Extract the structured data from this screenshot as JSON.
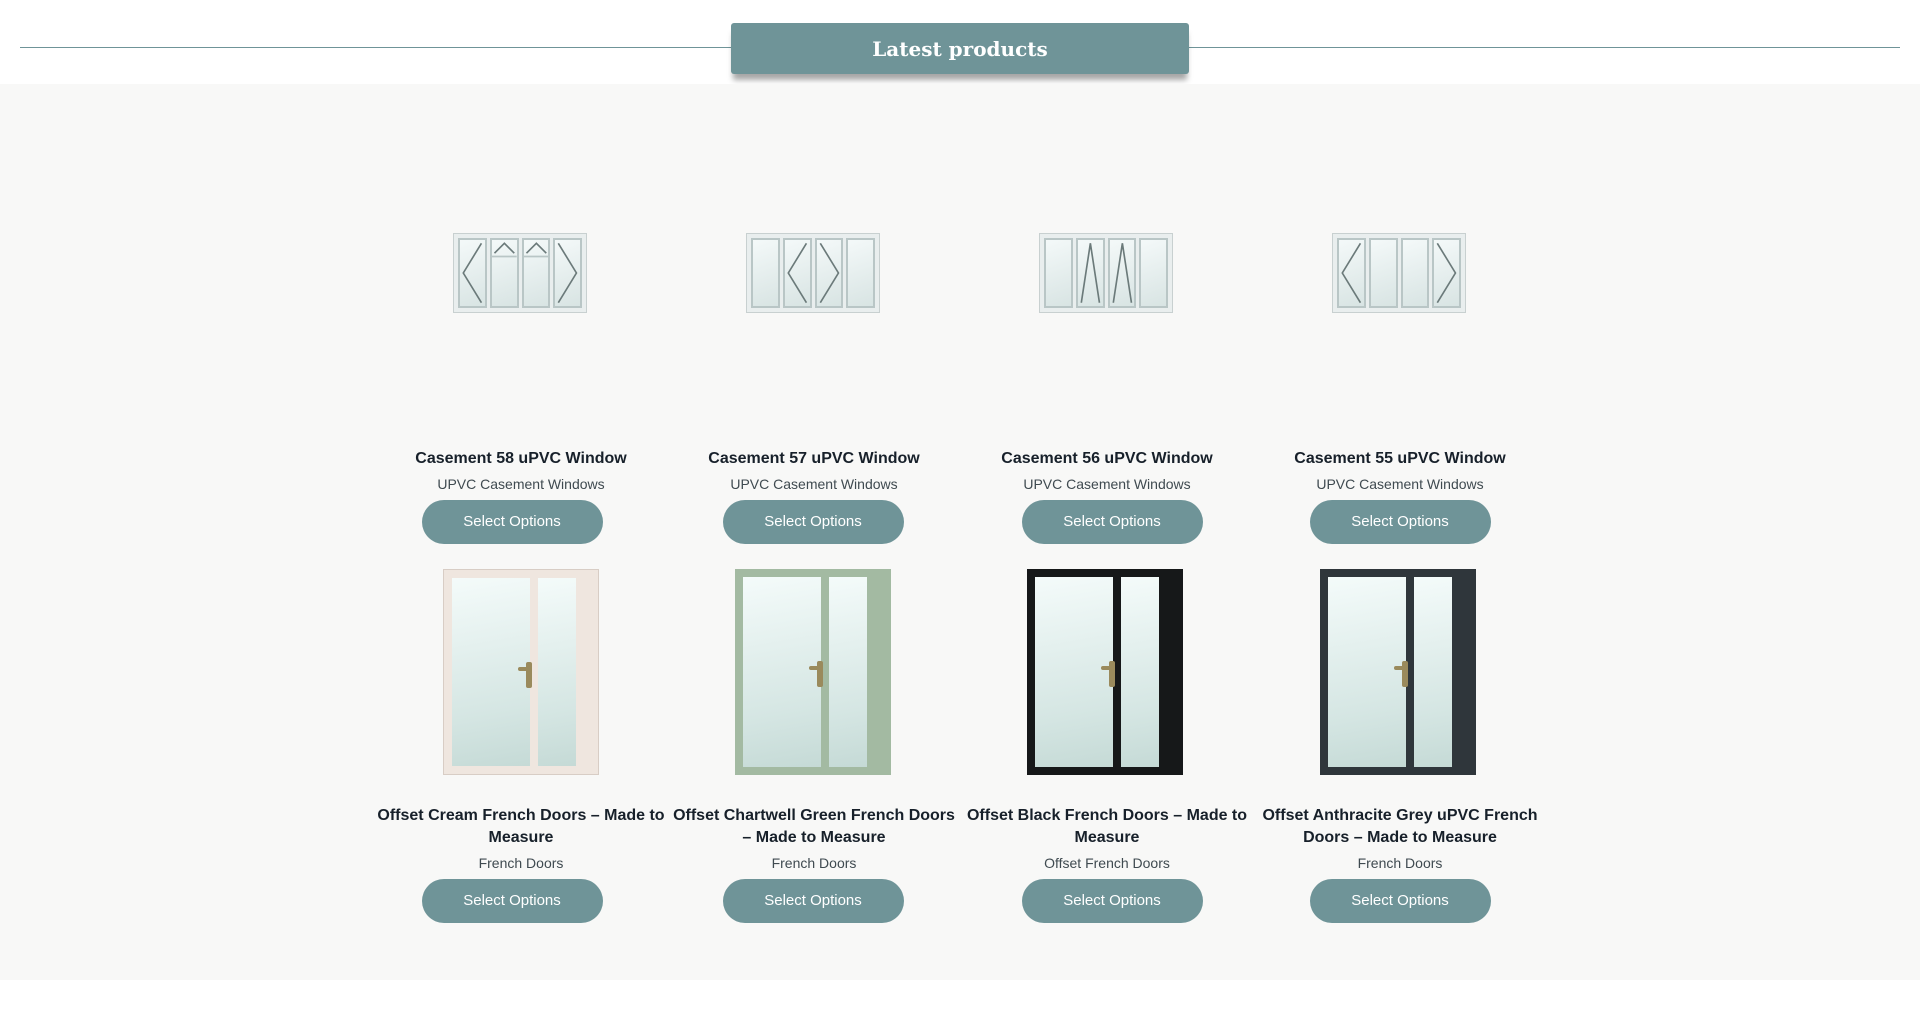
{
  "section": {
    "title": "Latest products"
  },
  "products": [
    {
      "name": "Casement 58 uPVC Window",
      "category": "UPVC Casement Windows",
      "button": "Select Options",
      "image": "casement-58-window-image"
    },
    {
      "name": "Casement 57 uPVC Window",
      "category": "UPVC Casement Windows",
      "button": "Select Options",
      "image": "casement-57-window-image"
    },
    {
      "name": "Casement 56 uPVC Window",
      "category": "UPVC Casement Windows",
      "button": "Select Options",
      "image": "casement-56-window-image"
    },
    {
      "name": "Casement 55 uPVC Window",
      "category": "UPVC Casement Windows",
      "button": "Select Options",
      "image": "casement-55-window-image"
    },
    {
      "name": "Offset Cream French Doors – Made to Measure",
      "category": "French Doors",
      "button": "Select Options",
      "frame_color": "#efe6df"
    },
    {
      "name": "Offset Chartwell Green French Doors – Made to Measure",
      "category": "French Doors",
      "button": "Select Options",
      "frame_color": "#a3baa2"
    },
    {
      "name": "Offset Black French Doors – Made to Measure",
      "category": "Offset French Doors",
      "button": "Select Options",
      "frame_color": "#161819"
    },
    {
      "name": "Offset Anthracite Grey uPVC French Doors – Made to Measure",
      "category": "French Doors",
      "button": "Select Options",
      "frame_color": "#2f363b"
    }
  ],
  "colors": {
    "accent": "#6f9498",
    "background": "#f8f8f7"
  }
}
